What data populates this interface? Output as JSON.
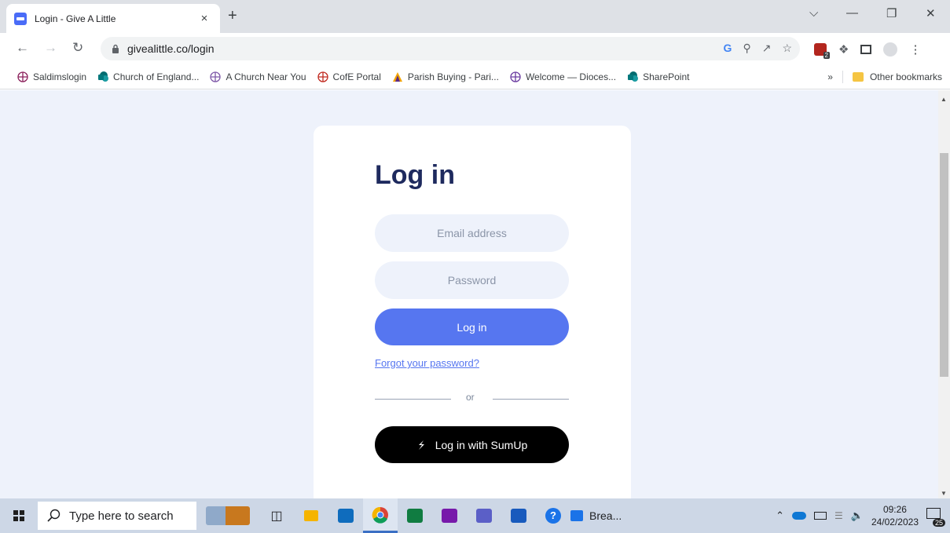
{
  "browser": {
    "tab_title": "Login - Give A Little",
    "tab_close": "×",
    "new_tab": "+",
    "url": "givealittle.co/login",
    "window_controls": {
      "dropdown": "⌵",
      "minimize": "—",
      "restore": "❐",
      "close": "✕"
    },
    "extension_badge": "2"
  },
  "bookmarks": [
    {
      "label": "Saldimslogin",
      "icon": "cross-circle-icon"
    },
    {
      "label": "Church of England...",
      "icon": "sharepoint-icon"
    },
    {
      "label": "A Church Near You",
      "icon": "cross-circle-icon"
    },
    {
      "label": "CofE Portal",
      "icon": "cross-circle-red-icon"
    },
    {
      "label": "Parish Buying - Pari...",
      "icon": "parish-icon"
    },
    {
      "label": "Welcome — Dioces...",
      "icon": "cross-circle-purple-icon"
    },
    {
      "label": "SharePoint",
      "icon": "sharepoint-icon"
    }
  ],
  "bookmarks_more": "»",
  "other_bookmarks": "Other bookmarks",
  "login": {
    "title": "Log in",
    "email_placeholder": "Email address",
    "password_placeholder": "Password",
    "login_button": "Log in",
    "forgot_link": "Forgot your password?",
    "or_text": "or",
    "sumup_button": "Log in with SumUp"
  },
  "taskbar": {
    "search_placeholder": "Type here to search",
    "weather_label": "Brea...",
    "time": "09:26",
    "date": "24/02/2023",
    "notification_count": "25"
  },
  "colors": {
    "page_bg": "#eef2fb",
    "primary": "#5676f0",
    "title": "#1e2a5e",
    "sumup": "#000000"
  }
}
